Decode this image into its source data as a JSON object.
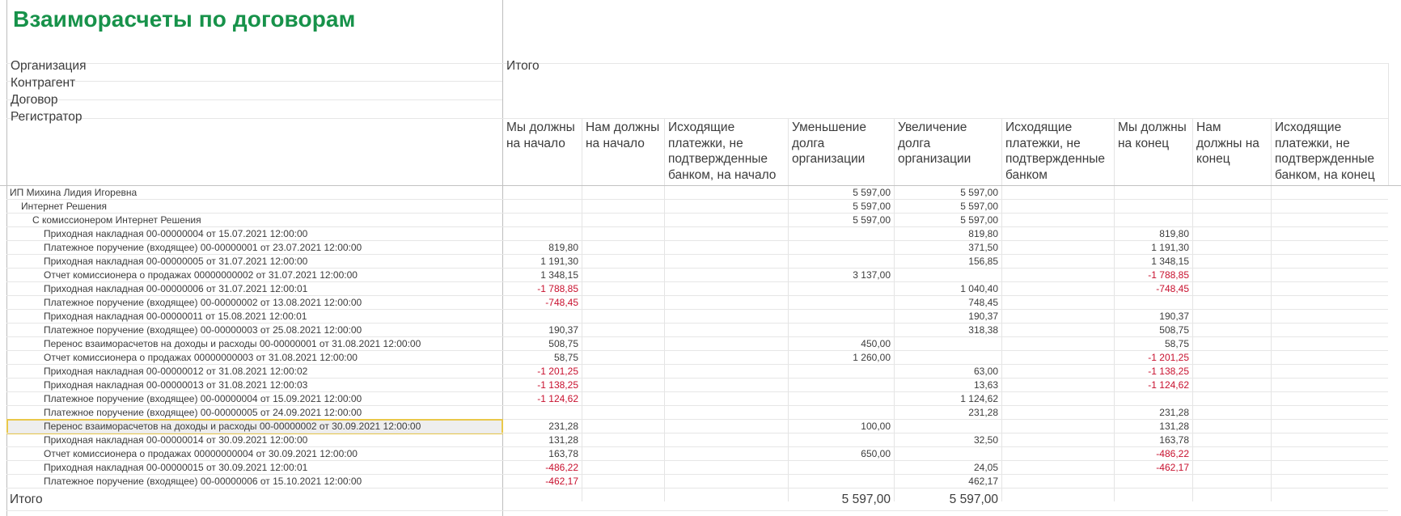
{
  "report": {
    "title": "Взаиморасчеты по договорам",
    "grouping_labels": [
      "Организация",
      "Контрагент",
      "Договор",
      "Регистратор"
    ],
    "total_group_label": "Итого",
    "columns": [
      "Мы должны на начало",
      "Нам должны на начало",
      "Исходящие платежки, не подтвержденные банком, на начало",
      "Уменьшение долга организации",
      "Увеличение долга организации",
      "Исходящие платежки, не подтвержденные банком",
      "Мы должны на конец",
      "Нам должны на конец",
      "Исходящие платежки, не подтвержденные банком, на конец"
    ],
    "rows": [
      {
        "label": "ИП Михина Лидия Игоревна",
        "level": 0,
        "values": [
          "",
          "",
          "",
          "5 597,00",
          "5 597,00",
          "",
          "",
          "",
          ""
        ]
      },
      {
        "label": "Интернет Решения",
        "level": 1,
        "values": [
          "",
          "",
          "",
          "5 597,00",
          "5 597,00",
          "",
          "",
          "",
          ""
        ]
      },
      {
        "label": "С комиссионером Интернет Решения",
        "level": 2,
        "values": [
          "",
          "",
          "",
          "5 597,00",
          "5 597,00",
          "",
          "",
          "",
          ""
        ]
      },
      {
        "label": "Приходная накладная 00-00000004 от 15.07.2021 12:00:00",
        "level": 3,
        "values": [
          "",
          "",
          "",
          "",
          "819,80",
          "",
          "819,80",
          "",
          ""
        ]
      },
      {
        "label": "Платежное поручение (входящее) 00-00000001 от 23.07.2021 12:00:00",
        "level": 3,
        "values": [
          "819,80",
          "",
          "",
          "",
          "371,50",
          "",
          "1 191,30",
          "",
          ""
        ]
      },
      {
        "label": "Приходная накладная 00-00000005 от 31.07.2021 12:00:00",
        "level": 3,
        "values": [
          "1 191,30",
          "",
          "",
          "",
          "156,85",
          "",
          "1 348,15",
          "",
          ""
        ]
      },
      {
        "label": "Отчет комиссионера о продажах 00000000002 от 31.07.2021 12:00:00",
        "level": 3,
        "values": [
          "1 348,15",
          "",
          "",
          "3 137,00",
          "",
          "",
          "-1 788,85",
          "",
          ""
        ]
      },
      {
        "label": "Приходная накладная 00-00000006 от 31.07.2021 12:00:01",
        "level": 3,
        "values": [
          "-1 788,85",
          "",
          "",
          "",
          "1 040,40",
          "",
          "-748,45",
          "",
          ""
        ]
      },
      {
        "label": "Платежное поручение (входящее) 00-00000002 от 13.08.2021 12:00:00",
        "level": 3,
        "values": [
          "-748,45",
          "",
          "",
          "",
          "748,45",
          "",
          "",
          "",
          ""
        ]
      },
      {
        "label": "Приходная накладная 00-00000011 от 15.08.2021 12:00:01",
        "level": 3,
        "values": [
          "",
          "",
          "",
          "",
          "190,37",
          "",
          "190,37",
          "",
          ""
        ]
      },
      {
        "label": "Платежное поручение (входящее) 00-00000003 от 25.08.2021 12:00:00",
        "level": 3,
        "values": [
          "190,37",
          "",
          "",
          "",
          "318,38",
          "",
          "508,75",
          "",
          ""
        ]
      },
      {
        "label": "Перенос взаиморасчетов на доходы и расходы 00-00000001 от 31.08.2021 12:00:00",
        "level": 3,
        "values": [
          "508,75",
          "",
          "",
          "450,00",
          "",
          "",
          "58,75",
          "",
          ""
        ]
      },
      {
        "label": "Отчет комиссионера о продажах 00000000003 от 31.08.2021 12:00:00",
        "level": 3,
        "values": [
          "58,75",
          "",
          "",
          "1 260,00",
          "",
          "",
          "-1 201,25",
          "",
          ""
        ]
      },
      {
        "label": "Приходная накладная 00-00000012 от 31.08.2021 12:00:02",
        "level": 3,
        "values": [
          "-1 201,25",
          "",
          "",
          "",
          "63,00",
          "",
          "-1 138,25",
          "",
          ""
        ]
      },
      {
        "label": "Приходная накладная 00-00000013 от 31.08.2021 12:00:03",
        "level": 3,
        "values": [
          "-1 138,25",
          "",
          "",
          "",
          "13,63",
          "",
          "-1 124,62",
          "",
          ""
        ]
      },
      {
        "label": "Платежное поручение (входящее) 00-00000004 от 15.09.2021 12:00:00",
        "level": 3,
        "values": [
          "-1 124,62",
          "",
          "",
          "",
          "1 124,62",
          "",
          "",
          "",
          ""
        ]
      },
      {
        "label": "Платежное поручение (входящее) 00-00000005 от 24.09.2021 12:00:00",
        "level": 3,
        "values": [
          "",
          "",
          "",
          "",
          "231,28",
          "",
          "231,28",
          "",
          ""
        ]
      },
      {
        "label": "Перенос взаиморасчетов на доходы и расходы 00-00000002 от 30.09.2021 12:00:00",
        "level": 3,
        "selected": true,
        "values": [
          "231,28",
          "",
          "",
          "100,00",
          "",
          "",
          "131,28",
          "",
          ""
        ]
      },
      {
        "label": "Приходная накладная 00-00000014 от 30.09.2021 12:00:00",
        "level": 3,
        "values": [
          "131,28",
          "",
          "",
          "",
          "32,50",
          "",
          "163,78",
          "",
          ""
        ]
      },
      {
        "label": "Отчет комиссионера о продажах 00000000004 от 30.09.2021 12:00:00",
        "level": 3,
        "values": [
          "163,78",
          "",
          "",
          "650,00",
          "",
          "",
          "-486,22",
          "",
          ""
        ]
      },
      {
        "label": "Приходная накладная 00-00000015 от 30.09.2021 12:00:01",
        "level": 3,
        "values": [
          "-486,22",
          "",
          "",
          "",
          "24,05",
          "",
          "-462,17",
          "",
          ""
        ]
      },
      {
        "label": "Платежное поручение (входящее) 00-00000006 от 15.10.2021 12:00:00",
        "level": 3,
        "values": [
          "-462,17",
          "",
          "",
          "",
          "462,17",
          "",
          "",
          "",
          ""
        ]
      }
    ],
    "total": {
      "label": "Итого",
      "values": [
        "",
        "",
        "",
        "5 597,00",
        "5 597,00",
        "",
        "",
        "",
        ""
      ]
    }
  }
}
